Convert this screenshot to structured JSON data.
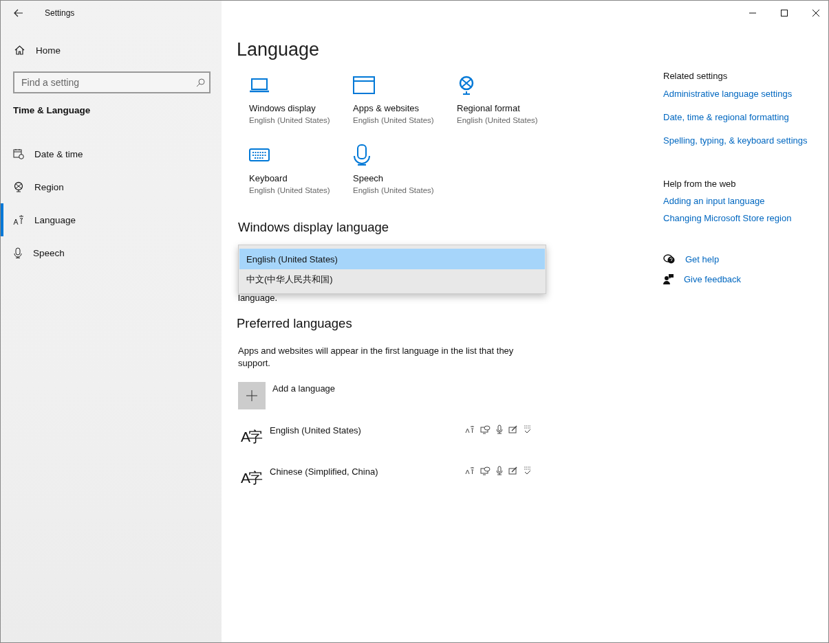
{
  "window": {
    "title": "Settings"
  },
  "sidebar": {
    "home": "Home",
    "search": {
      "placeholder": "Find a setting"
    },
    "section": "Time & Language",
    "items": [
      {
        "label": "Date & time",
        "kind": "calendar",
        "selected": false
      },
      {
        "label": "Region",
        "kind": "globe",
        "selected": false
      },
      {
        "label": "Language",
        "kind": "language",
        "selected": true
      },
      {
        "label": "Speech",
        "kind": "mic",
        "selected": false
      }
    ]
  },
  "page_title": "Language",
  "tiles": [
    {
      "kind": "laptop",
      "title": "Windows display",
      "subtitle": "English (United States)"
    },
    {
      "kind": "window",
      "title": "Apps & websites",
      "subtitle": "English (United States)"
    },
    {
      "kind": "globe",
      "title": "Regional format",
      "subtitle": "English (United States)"
    },
    {
      "kind": "keyboard",
      "title": "Keyboard",
      "subtitle": "English (United States)"
    },
    {
      "kind": "mic",
      "title": "Speech",
      "subtitle": "English (United States)"
    }
  ],
  "display_language": {
    "heading": "Windows display language",
    "description_visible": "language.",
    "dropdown": [
      {
        "label": "English (United States)",
        "selected": true
      },
      {
        "label": "中文(中华人民共和国)",
        "selected": false
      }
    ]
  },
  "preferred": {
    "heading": "Preferred languages",
    "description": "Apps and websites will appear in the first language in the list that they support.",
    "add_label": "Add a language",
    "languages": [
      {
        "glyph": "A字",
        "name": "English (United States)"
      },
      {
        "glyph": "A字",
        "name": "Chinese (Simplified, China)"
      }
    ]
  },
  "related": {
    "heading": "Related settings",
    "links": [
      "Administrative language settings",
      "Date, time & regional formatting",
      "Spelling, typing, & keyboard settings"
    ]
  },
  "help": {
    "heading": "Help from the web",
    "links": [
      "Adding an input language",
      "Changing Microsoft Store region"
    ]
  },
  "support": [
    {
      "kind": "help",
      "label": "Get help"
    },
    {
      "kind": "feedback",
      "label": "Give feedback"
    }
  ]
}
